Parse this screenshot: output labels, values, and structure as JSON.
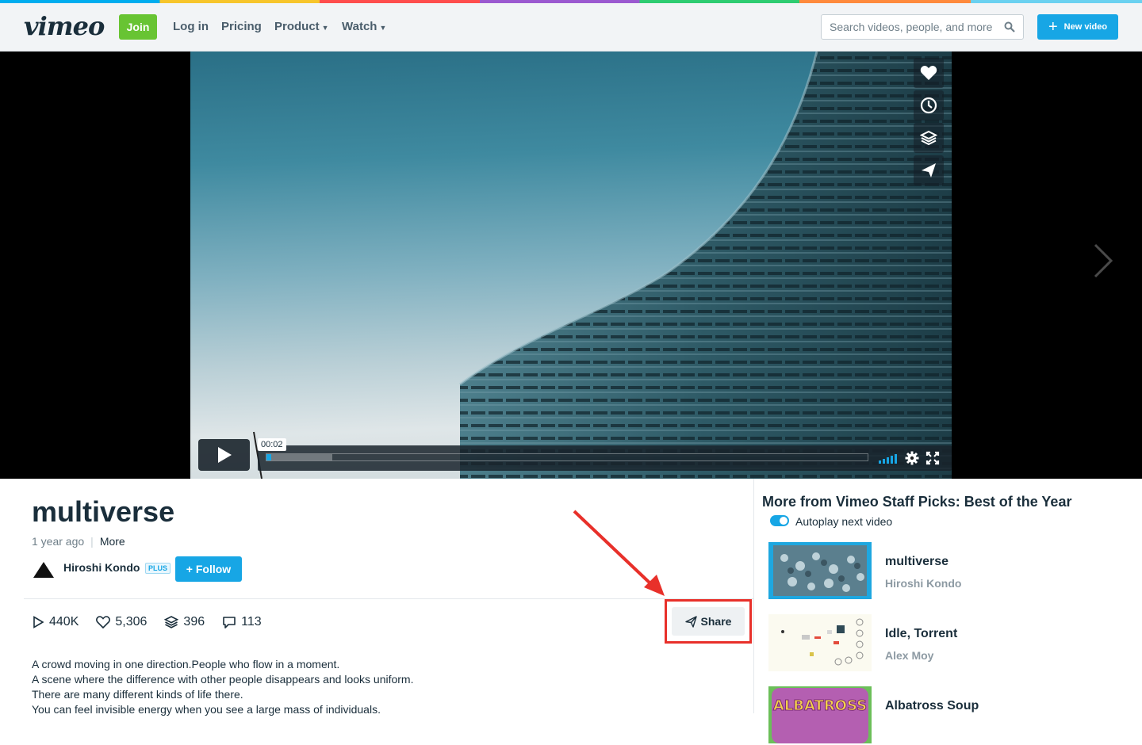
{
  "nav": {
    "logo": "vimeo",
    "join": "Join",
    "login": "Log in",
    "pricing": "Pricing",
    "product": "Product",
    "watch": "Watch",
    "search_placeholder": "Search videos, people, and more",
    "new_video": "New video"
  },
  "player": {
    "timecode": "00:02",
    "progress_played": 0.008,
    "progress_buffered": 0.11
  },
  "video": {
    "title": "multiverse",
    "posted": "1 year ago",
    "more": "More",
    "author": "Hiroshi Kondo",
    "badge": "PLUS",
    "follow": "Follow",
    "stats": {
      "plays": "440K",
      "likes": "5,306",
      "collections": "396",
      "comments": "113"
    },
    "share": "Share",
    "description": [
      "A crowd moving in one direction.People who flow in a moment.",
      "A scene where the difference with other people disappears and looks uniform.",
      "There are many different kinds of life there.",
      "You can feel invisible energy when you see a large mass of individuals."
    ]
  },
  "sidebar": {
    "title": "More from Vimeo Staff Picks: Best of the Year",
    "autoplay": "Autoplay next video",
    "autoplay_on": true,
    "items": [
      {
        "title": "multiverse",
        "author": "Hiroshi Kondo"
      },
      {
        "title": "Idle, Torrent",
        "author": "Alex Moy"
      },
      {
        "title": "Albatross Soup",
        "author": ""
      }
    ],
    "thumb3_text": "ALBATROSS"
  },
  "colors": {
    "accent": "#17a6e5",
    "join": "#68c433",
    "highlight": "#e8302a"
  }
}
